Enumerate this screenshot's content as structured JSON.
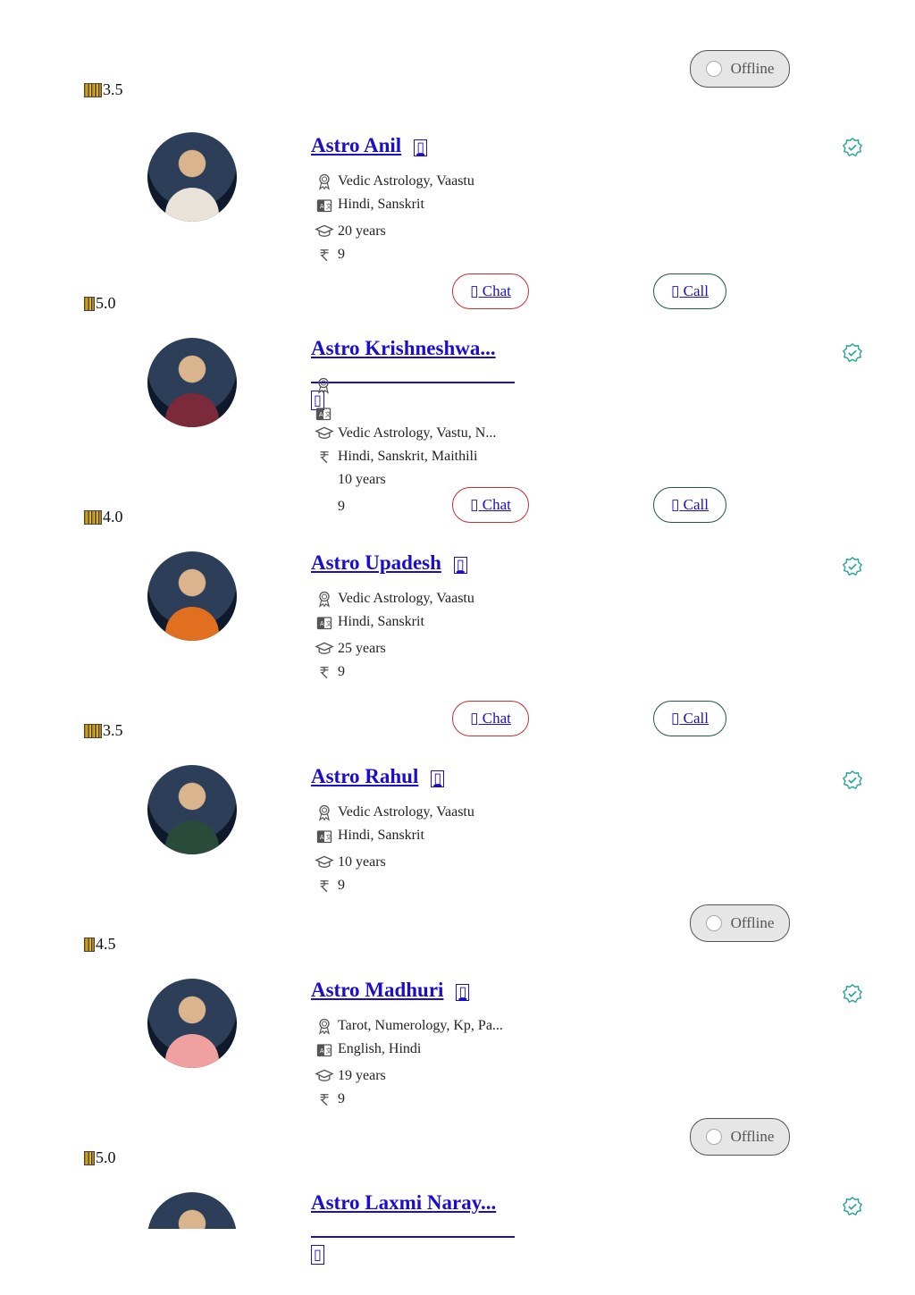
{
  "labels": {
    "chat": "Chat",
    "call": "Call",
    "offline": "Offline",
    "box": "▯"
  },
  "colors": {
    "link": "#1a0dcc",
    "chat_border": "#c82d2d",
    "call_border": "#1d5a3a",
    "verified": "#2aa59b"
  },
  "astrologers": [
    {
      "rating": "3.5",
      "name": "Astro Anil",
      "skills": "Vedic Astrology, Vaastu",
      "languages": "Hindi, Sanskrit",
      "experience": "20 years",
      "price": "9"
    },
    {
      "rating": "5.0",
      "name": "Astro Krishneshwa...",
      "skills": "Vedic Astrology, Vastu, N...",
      "languages": "Hindi, Sanskrit, Maithili",
      "experience": "10 years",
      "price": "9"
    },
    {
      "rating": "4.0",
      "name": "Astro Upadesh",
      "skills": "Vedic Astrology, Vaastu",
      "languages": "Hindi, Sanskrit",
      "experience": "25 years",
      "price": "9"
    },
    {
      "rating": "3.5",
      "name": "Astro Rahul",
      "skills": "Vedic Astrology, Vaastu",
      "languages": "Hindi, Sanskrit",
      "experience": "10 years",
      "price": "9"
    },
    {
      "rating": "4.5",
      "name": "Astro Madhuri",
      "skills": "Tarot, Numerology, Kp, Pa...",
      "languages": "English, Hindi",
      "experience": "19 years",
      "price": "9"
    },
    {
      "rating": "5.0",
      "name": "Astro Laxmi Naray..."
    }
  ]
}
